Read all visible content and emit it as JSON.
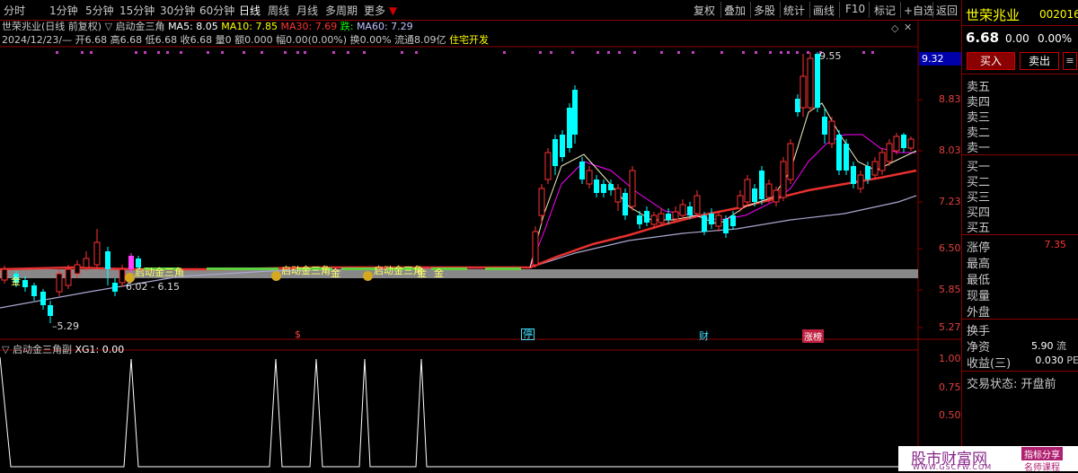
{
  "toolbar": {
    "periods": [
      "分时",
      "1分钟",
      "5分钟",
      "15分钟",
      "30分钟",
      "60分钟",
      "日线",
      "周线",
      "月线",
      "多周期",
      "更多"
    ],
    "active": "日线",
    "right": [
      "复权",
      "叠加",
      "多股",
      "统计",
      "画线",
      "F10",
      "标记",
      "+自选",
      "返回"
    ]
  },
  "info": {
    "name": "世荣兆业",
    "mode": "(日线 前复权)",
    "formula": "启动金三角",
    "ma5": "MA5: 8.05",
    "ma10": "MA10: 7.85",
    "ma30": "MA30: 7.69",
    "die": "跌:",
    "ma60": "MA60: 7.29",
    "date": "2024/12/23/—",
    "ohlc": "开6.68 高6.68 低6.68 收6.68",
    "vol": "量0 额0.000",
    "chg": "幅0.00(0.00%)",
    "turn": "换0.00%",
    "float": "流通8.09亿",
    "sector": "住宅开发"
  },
  "price_axis": {
    "current": "9.32",
    "ticks": [
      "8.83",
      "8.03",
      "7.23",
      "6.50",
      "5.85",
      "5.27"
    ]
  },
  "annotations": {
    "high": "9.55",
    "low": "5.29",
    "range": "6.02 - 6.15",
    "signal": "启动金三角",
    "signal2": "启动金三角",
    "signal3": "启动金三角",
    "gold": "金",
    "gold2": "金",
    "gold3": "金",
    "gold4": "金",
    "e1": "$",
    "e2": "停",
    "e3": "财",
    "e4": "涨榜"
  },
  "sub": {
    "title": "启动金三角副",
    "xg": "XG1: 0.00",
    "ticks": [
      "1.00",
      "0.75",
      "0.50"
    ]
  },
  "stock": {
    "name": "世荣兆业",
    "code": "002016",
    "price": "6.68",
    "change": "0.00",
    "pct": "0.00%",
    "buy": "买入",
    "sell": "卖出",
    "sell_levels": [
      "卖五",
      "卖四",
      "卖三",
      "卖二",
      "卖一"
    ],
    "buy_levels": [
      "买一",
      "买二",
      "买三",
      "买四",
      "买五"
    ],
    "limit_up_label": "涨停",
    "limit_up_val": "7.35",
    "high_label": "最高",
    "low_label": "最低",
    "now_label": "现量",
    "outer_label": "外盘",
    "turn_label": "换手",
    "nav_label": "净资",
    "nav_val": "5.90",
    "nav_suffix": "流",
    "eps_label": "收益(三)",
    "eps_val": "0.030",
    "eps_suffix": "PE",
    "status": "交易状态: 开盘前"
  },
  "watermark": {
    "brand": "股市财富网",
    "tag1": "指标分享",
    "tag2": "名师课程",
    "url": "WWW.GSCFW.COM"
  },
  "colors": {
    "up": "#ff3232",
    "down": "#00ffff",
    "ma5": "#ffffff",
    "ma10": "#ffff00",
    "ma30": "#ff00ff",
    "ma60": "#c0c0ff"
  }
}
